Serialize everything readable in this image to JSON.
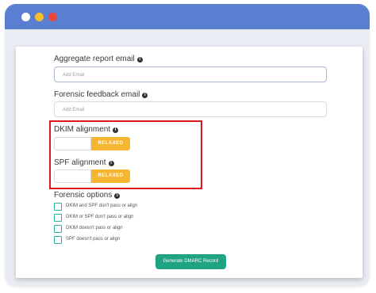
{
  "window": {
    "controls": [
      "white-dot",
      "yellow-dot",
      "red-dot"
    ]
  },
  "form": {
    "aggregate": {
      "label": "Aggregate report email",
      "placeholder": "Add Email"
    },
    "forensic_feedback": {
      "label": "Forensic feedback email",
      "placeholder": "Add Email"
    },
    "dkim": {
      "label": "DKIM alignment",
      "button_label": "RELAXED"
    },
    "spf": {
      "label": "SPF alignment",
      "button_label": "RELAXED"
    },
    "forensic_options": {
      "label": "Forensic options",
      "options": [
        "DKIM and SPF don't pass or align",
        "DKIM or SPF don't pass or align",
        "DKIM doesn't pass or align",
        "SPF doesn't pass or align"
      ]
    },
    "generate_label": "Generate DMARC Record"
  },
  "colors": {
    "titlebar": "#5b7fd0",
    "accent_orange": "#f6b632",
    "generate_green": "#1fa383",
    "checkbox_teal": "#2bb5a0",
    "highlight_red": "#d9191f"
  }
}
